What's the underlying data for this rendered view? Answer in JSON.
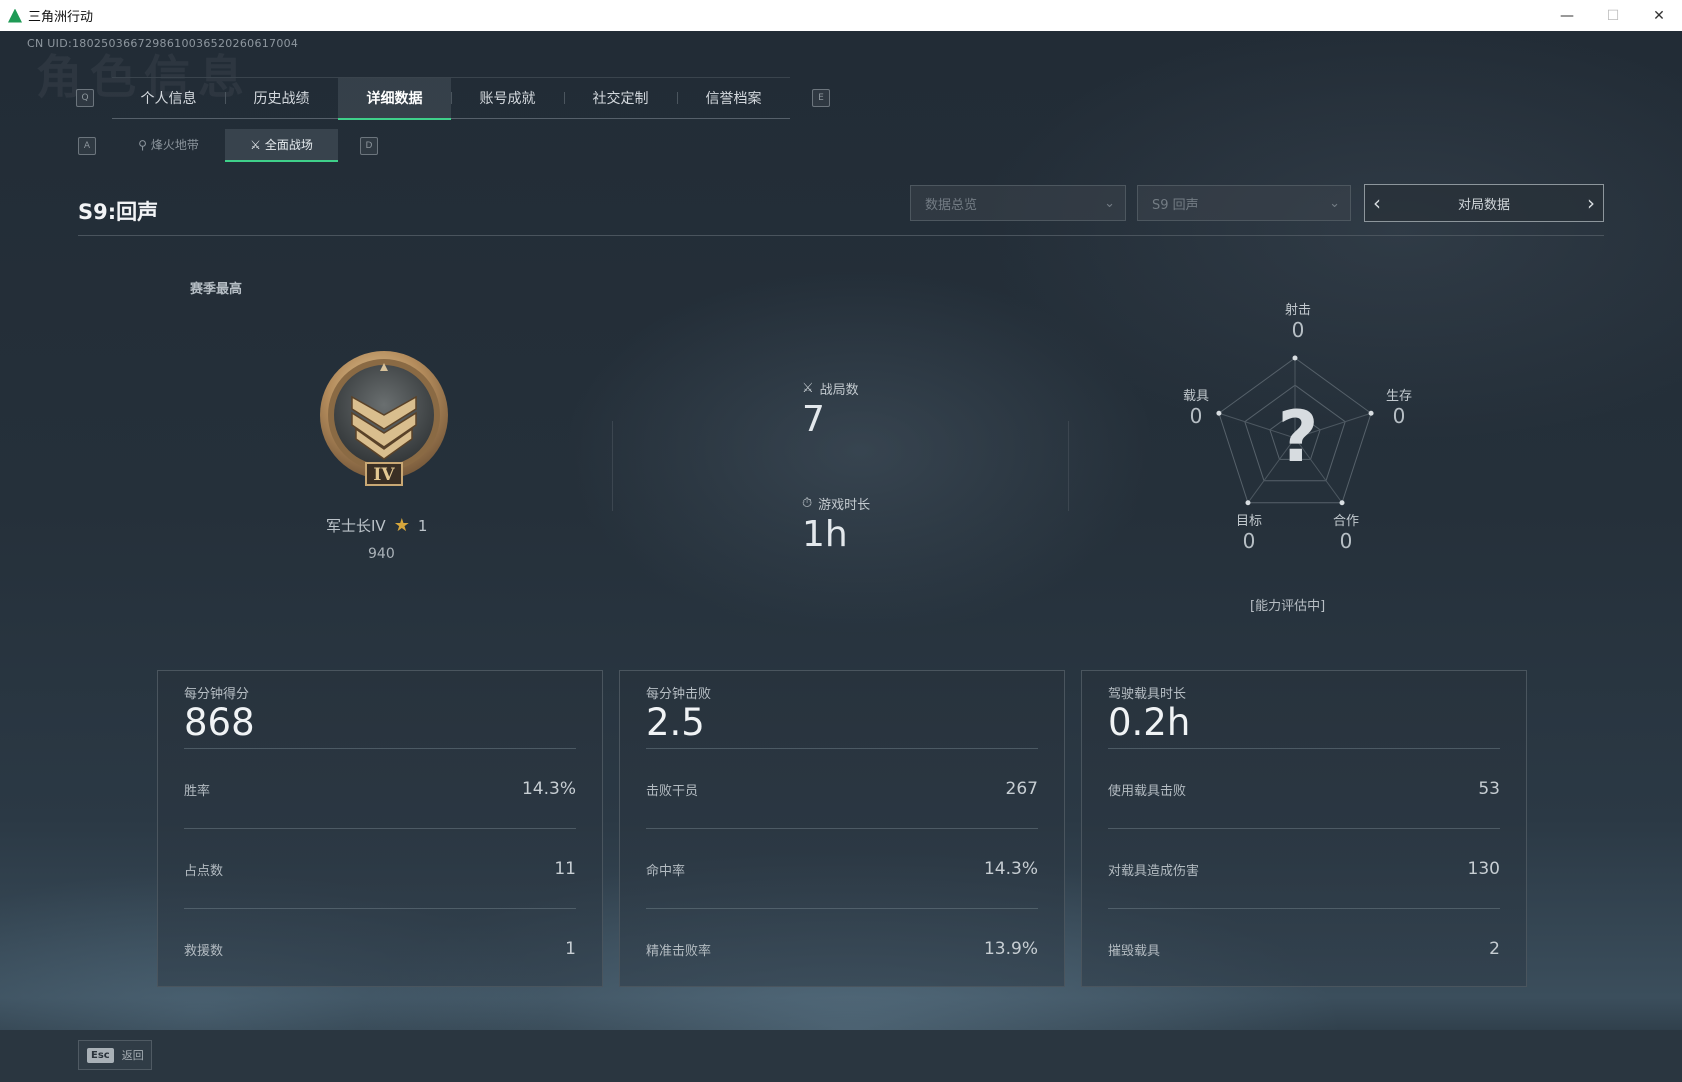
{
  "window": {
    "title": "三角洲行动"
  },
  "uid": "CN UID:1802503667298610036520260617004",
  "ghost_title": "角色信息",
  "keys": {
    "tab_left": "Q",
    "tab_right": "E",
    "sub_left": "A",
    "sub_right": "D",
    "esc": "Esc"
  },
  "tabs": [
    {
      "label": "个人信息"
    },
    {
      "label": "历史战绩"
    },
    {
      "label": "详细数据",
      "active": true
    },
    {
      "label": "账号成就"
    },
    {
      "label": "社交定制"
    },
    {
      "label": "信誉档案"
    }
  ],
  "subtabs": [
    {
      "label": "烽火地带",
      "icon": "fire-zone-icon"
    },
    {
      "label": "全面战场",
      "icon": "battlefield-icon",
      "active": true
    }
  ],
  "season": {
    "title": "S9:回声"
  },
  "filters": {
    "overview": "数据总览",
    "season": "S9 回声",
    "pager": "对局数据"
  },
  "rank": {
    "section_label": "赛季最高",
    "badge_numeral": "IV",
    "name": "军士长IV",
    "stars": "1",
    "points": "940"
  },
  "matches": {
    "label": "战局数",
    "value": "7"
  },
  "playtime": {
    "label": "游戏时长",
    "value": "1h"
  },
  "radar": {
    "center_mark": "?",
    "axes": [
      {
        "label": "射击",
        "value": "0"
      },
      {
        "label": "生存",
        "value": "0"
      },
      {
        "label": "合作",
        "value": "0"
      },
      {
        "label": "目标",
        "value": "0"
      },
      {
        "label": "载具",
        "value": "0"
      }
    ],
    "status": "[能力评估中]"
  },
  "cards": [
    {
      "head_label": "每分钟得分",
      "head_value": "868",
      "rows": [
        {
          "k": "胜率",
          "v": "14.3%"
        },
        {
          "k": "占点数",
          "v": "11"
        },
        {
          "k": "救援数",
          "v": "1"
        }
      ]
    },
    {
      "head_label": "每分钟击败",
      "head_value": "2.5",
      "rows": [
        {
          "k": "击败干员",
          "v": "267"
        },
        {
          "k": "命中率",
          "v": "14.3%"
        },
        {
          "k": "精准击败率",
          "v": "13.9%"
        }
      ]
    },
    {
      "head_label": "驾驶载具时长",
      "head_value": "0.2h",
      "rows": [
        {
          "k": "使用载具击败",
          "v": "53"
        },
        {
          "k": "对载具造成伤害",
          "v": "130"
        },
        {
          "k": "摧毁载具",
          "v": "2"
        }
      ]
    }
  ],
  "footer": {
    "back_label": "返回"
  },
  "colors": {
    "accent": "#3fd08a",
    "star": "#d6a63c",
    "badge_gold": "#b89466"
  }
}
